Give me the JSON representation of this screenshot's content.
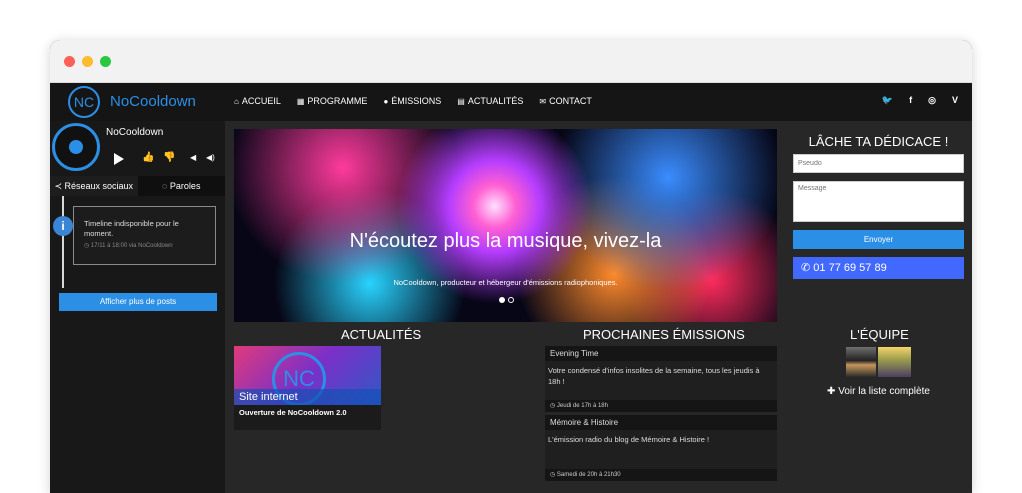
{
  "window": {
    "colors": {
      "red": "#fe5f57",
      "yellow": "#febc2e",
      "green": "#28c840"
    }
  },
  "navbar": {
    "logo_text": "NC",
    "brand": "NoCooldown",
    "items": [
      {
        "icon": "home-icon",
        "glyph": "⌂",
        "label": "ACCUEIL"
      },
      {
        "icon": "calendar-icon",
        "glyph": "▦",
        "label": "PROGRAMME"
      },
      {
        "icon": "microphone-icon",
        "glyph": "●",
        "label": "ÉMISSIONS"
      },
      {
        "icon": "news-icon",
        "glyph": "▤",
        "label": "ACTUALITÉS"
      },
      {
        "icon": "envelope-icon",
        "glyph": "✉",
        "label": "CONTACT"
      }
    ],
    "social": [
      {
        "icon": "twitter-icon",
        "glyph": "🐦"
      },
      {
        "icon": "facebook-icon",
        "glyph": "f"
      },
      {
        "icon": "instagram-icon",
        "glyph": "◎"
      },
      {
        "icon": "vine-icon",
        "glyph": "V"
      }
    ]
  },
  "player": {
    "name": "NoCooldown",
    "tabs": [
      {
        "icon": "share-icon",
        "glyph": "≺",
        "label": "Réseaux sociaux"
      },
      {
        "icon": "comment-icon",
        "glyph": "◌",
        "label": "Paroles"
      }
    ],
    "timeline": {
      "text": "Timeline indisponible pour le moment.",
      "meta": "17/11 à 18:00 via NoCooldown"
    },
    "more_posts": "Afficher plus de posts"
  },
  "hero": {
    "title": "N'écoutez plus la musique, vivez-la",
    "subtitle": "NoCooldown, producteur et hébergeur d'émissions radiophoniques."
  },
  "dedicace": {
    "title": "LÂCHE TA DÉDICACE !",
    "pseudo_placeholder": "Pseudo",
    "message_placeholder": "Message",
    "send": "Envoyer",
    "phone": "01 77 69 57 89"
  },
  "sections": {
    "actualites": "ACTUALITÉS",
    "prochaines": "PROCHAINES ÉMISSIONS",
    "equipe": "L'ÉQUIPE"
  },
  "news": {
    "logo_text": "NC",
    "label": "Site internet",
    "subtitle": "Ouverture de NoCooldown 2.0"
  },
  "shows": [
    {
      "title": "Evening Time",
      "description": "Votre condensé d'infos insolites de la semaine, tous les jeudis à 18h !",
      "time": "Jeudi de 17h à 18h"
    },
    {
      "title": "Mémoire & Histoire",
      "description": "L'émission radio du blog de Mémoire & Histoire !",
      "time": "Samedi de 20h à 21h30"
    }
  ],
  "team": {
    "link": "Voir la liste complète"
  }
}
